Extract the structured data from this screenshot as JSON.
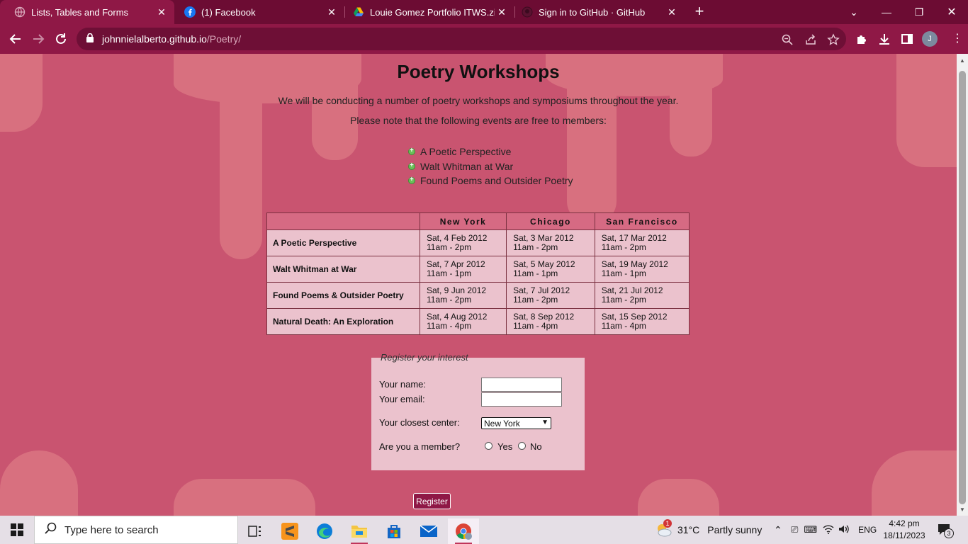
{
  "browser": {
    "tabs": [
      {
        "title": "Lists, Tables and Forms",
        "active": true
      },
      {
        "title": "(1) Facebook",
        "active": false
      },
      {
        "title": "Louie Gomez Portfolio ITWS.zip",
        "active": false
      },
      {
        "title": "Sign in to GitHub · GitHub",
        "active": false
      }
    ],
    "url_host": "johnnielalberto.github.io",
    "url_path": "/Poetry/",
    "profile_initial": "J"
  },
  "page": {
    "title": "Poetry Workshops",
    "intro_1": "We will be conducting a number of poetry workshops and symposiums throughout the year.",
    "intro_2": "Please note that the following events are free to members:",
    "events": [
      "A Poetic Perspective",
      "Walt Whitman at War",
      "Found Poems and Outsider Poetry"
    ],
    "table": {
      "headers": [
        "",
        "New York",
        "Chicago",
        "San Francisco"
      ],
      "rows": [
        {
          "event": "A Poetic Perspective",
          "cells": [
            {
              "date": "Sat, 4 Feb 2012",
              "time": "11am - 2pm"
            },
            {
              "date": "Sat, 3 Mar 2012",
              "time": "11am - 2pm"
            },
            {
              "date": "Sat, 17 Mar 2012",
              "time": "11am - 2pm"
            }
          ]
        },
        {
          "event": "Walt Whitman at War",
          "cells": [
            {
              "date": "Sat, 7 Apr 2012",
              "time": "11am - 1pm"
            },
            {
              "date": "Sat, 5 May 2012",
              "time": "11am - 1pm"
            },
            {
              "date": "Sat, 19 May 2012",
              "time": "11am - 1pm"
            }
          ]
        },
        {
          "event": "Found Poems & Outsider Poetry",
          "cells": [
            {
              "date": "Sat, 9 Jun 2012",
              "time": "11am - 2pm"
            },
            {
              "date": "Sat, 7 Jul 2012",
              "time": "11am - 2pm"
            },
            {
              "date": "Sat, 21 Jul 2012",
              "time": "11am - 2pm"
            }
          ]
        },
        {
          "event": "Natural Death: An Exploration",
          "cells": [
            {
              "date": "Sat, 4 Aug 2012",
              "time": "11am - 4pm"
            },
            {
              "date": "Sat, 8 Sep 2012",
              "time": "11am - 4pm"
            },
            {
              "date": "Sat, 15 Sep 2012",
              "time": "11am - 4pm"
            }
          ]
        }
      ]
    },
    "form": {
      "legend": "Register your interest",
      "name_label": "Your name:",
      "name_value": "",
      "email_label": "Your email:",
      "email_value": "",
      "center_label": "Your closest center:",
      "center_selected": "New York",
      "member_label": "Are you a member?",
      "member_yes": "Yes",
      "member_no": "No",
      "submit_label": "Register"
    }
  },
  "taskbar": {
    "search_placeholder": "Type here to search",
    "weather_temp": "31°C",
    "weather_text": "Partly sunny",
    "weather_badge": "1",
    "language": "ENG",
    "time": "4:42 pm",
    "date": "18/11/2023",
    "notification_count": "3"
  },
  "colors": {
    "page_background": "#c95470",
    "browser_frame": "#6c0c33",
    "toolbar": "#8f1846",
    "table_header": "#d66a83",
    "table_cell": "#ebc2cd",
    "button": "#8f1846"
  }
}
